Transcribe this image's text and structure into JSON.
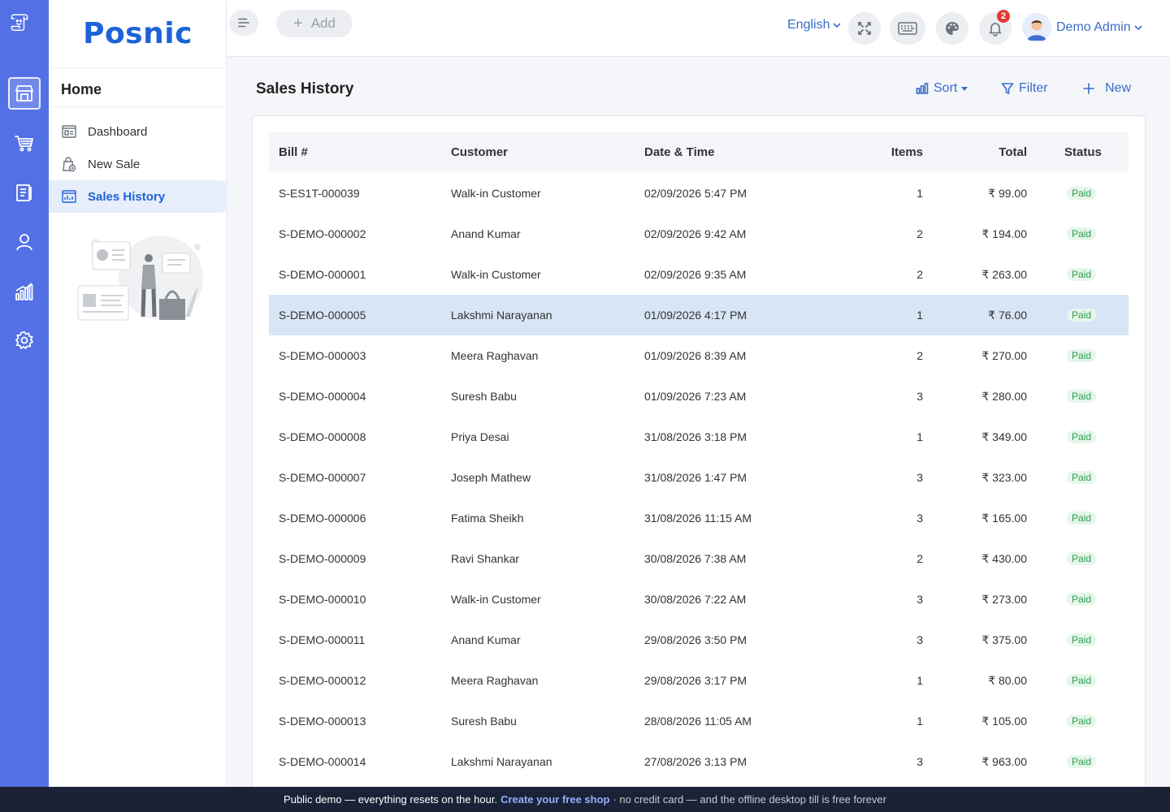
{
  "app": {
    "brand": "Posnic"
  },
  "rail": {
    "items": [
      {
        "name": "store-icon",
        "active": true
      },
      {
        "name": "cart-icon",
        "active": false
      },
      {
        "name": "clipboard-icon",
        "active": false
      },
      {
        "name": "user-icon",
        "active": false
      },
      {
        "name": "chart-icon",
        "active": false
      },
      {
        "name": "gear-icon",
        "active": false
      }
    ]
  },
  "sidebar": {
    "section_title": "Home",
    "items": [
      {
        "label": "Dashboard",
        "icon": "dashboard-icon"
      },
      {
        "label": "New Sale",
        "icon": "new-sale-icon"
      },
      {
        "label": "Sales History",
        "icon": "sales-history-icon",
        "active": true
      }
    ]
  },
  "topbar": {
    "add_label": "Add",
    "language": "English",
    "notifications_count": "2",
    "user_name": "Demo Admin"
  },
  "page": {
    "title": "Sales History",
    "actions": {
      "sort": "Sort",
      "filter": "Filter",
      "new": "New"
    }
  },
  "table": {
    "columns": {
      "bill": "Bill #",
      "customer": "Customer",
      "date": "Date & Time",
      "items": "Items",
      "total": "Total",
      "status": "Status"
    },
    "rows": [
      {
        "bill": "S-ES1T-000039",
        "customer": "Walk-in Customer",
        "date": "02/09/2026 5:47 PM",
        "items": "1",
        "total": "₹ 99.00",
        "status": "Paid"
      },
      {
        "bill": "S-DEMO-000002",
        "customer": "Anand Kumar",
        "date": "02/09/2026 9:42 AM",
        "items": "2",
        "total": "₹ 194.00",
        "status": "Paid"
      },
      {
        "bill": "S-DEMO-000001",
        "customer": "Walk-in Customer",
        "date": "02/09/2026 9:35 AM",
        "items": "2",
        "total": "₹ 263.00",
        "status": "Paid"
      },
      {
        "bill": "S-DEMO-000005",
        "customer": "Lakshmi Narayanan",
        "date": "01/09/2026 4:17 PM",
        "items": "1",
        "total": "₹ 76.00",
        "status": "Paid",
        "selected": true
      },
      {
        "bill": "S-DEMO-000003",
        "customer": "Meera Raghavan",
        "date": "01/09/2026 8:39 AM",
        "items": "2",
        "total": "₹ 270.00",
        "status": "Paid"
      },
      {
        "bill": "S-DEMO-000004",
        "customer": "Suresh Babu",
        "date": "01/09/2026 7:23 AM",
        "items": "3",
        "total": "₹ 280.00",
        "status": "Paid"
      },
      {
        "bill": "S-DEMO-000008",
        "customer": "Priya Desai",
        "date": "31/08/2026 3:18 PM",
        "items": "1",
        "total": "₹ 349.00",
        "status": "Paid"
      },
      {
        "bill": "S-DEMO-000007",
        "customer": "Joseph Mathew",
        "date": "31/08/2026 1:47 PM",
        "items": "3",
        "total": "₹ 323.00",
        "status": "Paid"
      },
      {
        "bill": "S-DEMO-000006",
        "customer": "Fatima Sheikh",
        "date": "31/08/2026 11:15 AM",
        "items": "3",
        "total": "₹ 165.00",
        "status": "Paid"
      },
      {
        "bill": "S-DEMO-000009",
        "customer": "Ravi Shankar",
        "date": "30/08/2026 7:38 AM",
        "items": "2",
        "total": "₹ 430.00",
        "status": "Paid"
      },
      {
        "bill": "S-DEMO-000010",
        "customer": "Walk-in Customer",
        "date": "30/08/2026 7:22 AM",
        "items": "3",
        "total": "₹ 273.00",
        "status": "Paid"
      },
      {
        "bill": "S-DEMO-000011",
        "customer": "Anand Kumar",
        "date": "29/08/2026 3:50 PM",
        "items": "3",
        "total": "₹ 375.00",
        "status": "Paid"
      },
      {
        "bill": "S-DEMO-000012",
        "customer": "Meera Raghavan",
        "date": "29/08/2026 3:17 PM",
        "items": "1",
        "total": "₹ 80.00",
        "status": "Paid"
      },
      {
        "bill": "S-DEMO-000013",
        "customer": "Suresh Babu",
        "date": "28/08/2026 11:05 AM",
        "items": "1",
        "total": "₹ 105.00",
        "status": "Paid"
      },
      {
        "bill": "S-DEMO-000014",
        "customer": "Lakshmi Narayanan",
        "date": "27/08/2026 3:13 PM",
        "items": "3",
        "total": "₹ 963.00",
        "status": "Paid"
      }
    ]
  },
  "footer": {
    "lead": "Public demo — everything resets on the hour.",
    "link": "Create your free shop",
    "tail": "· no credit card — and the offline desktop till is free forever"
  },
  "colors": {
    "rail": "#5470e6",
    "accent": "#1c63d8",
    "selected_row": "#d7e5f5",
    "paid_bg": "#e5f6ea",
    "paid_text": "#2e9d4e",
    "footer_bg": "#1c2236"
  }
}
